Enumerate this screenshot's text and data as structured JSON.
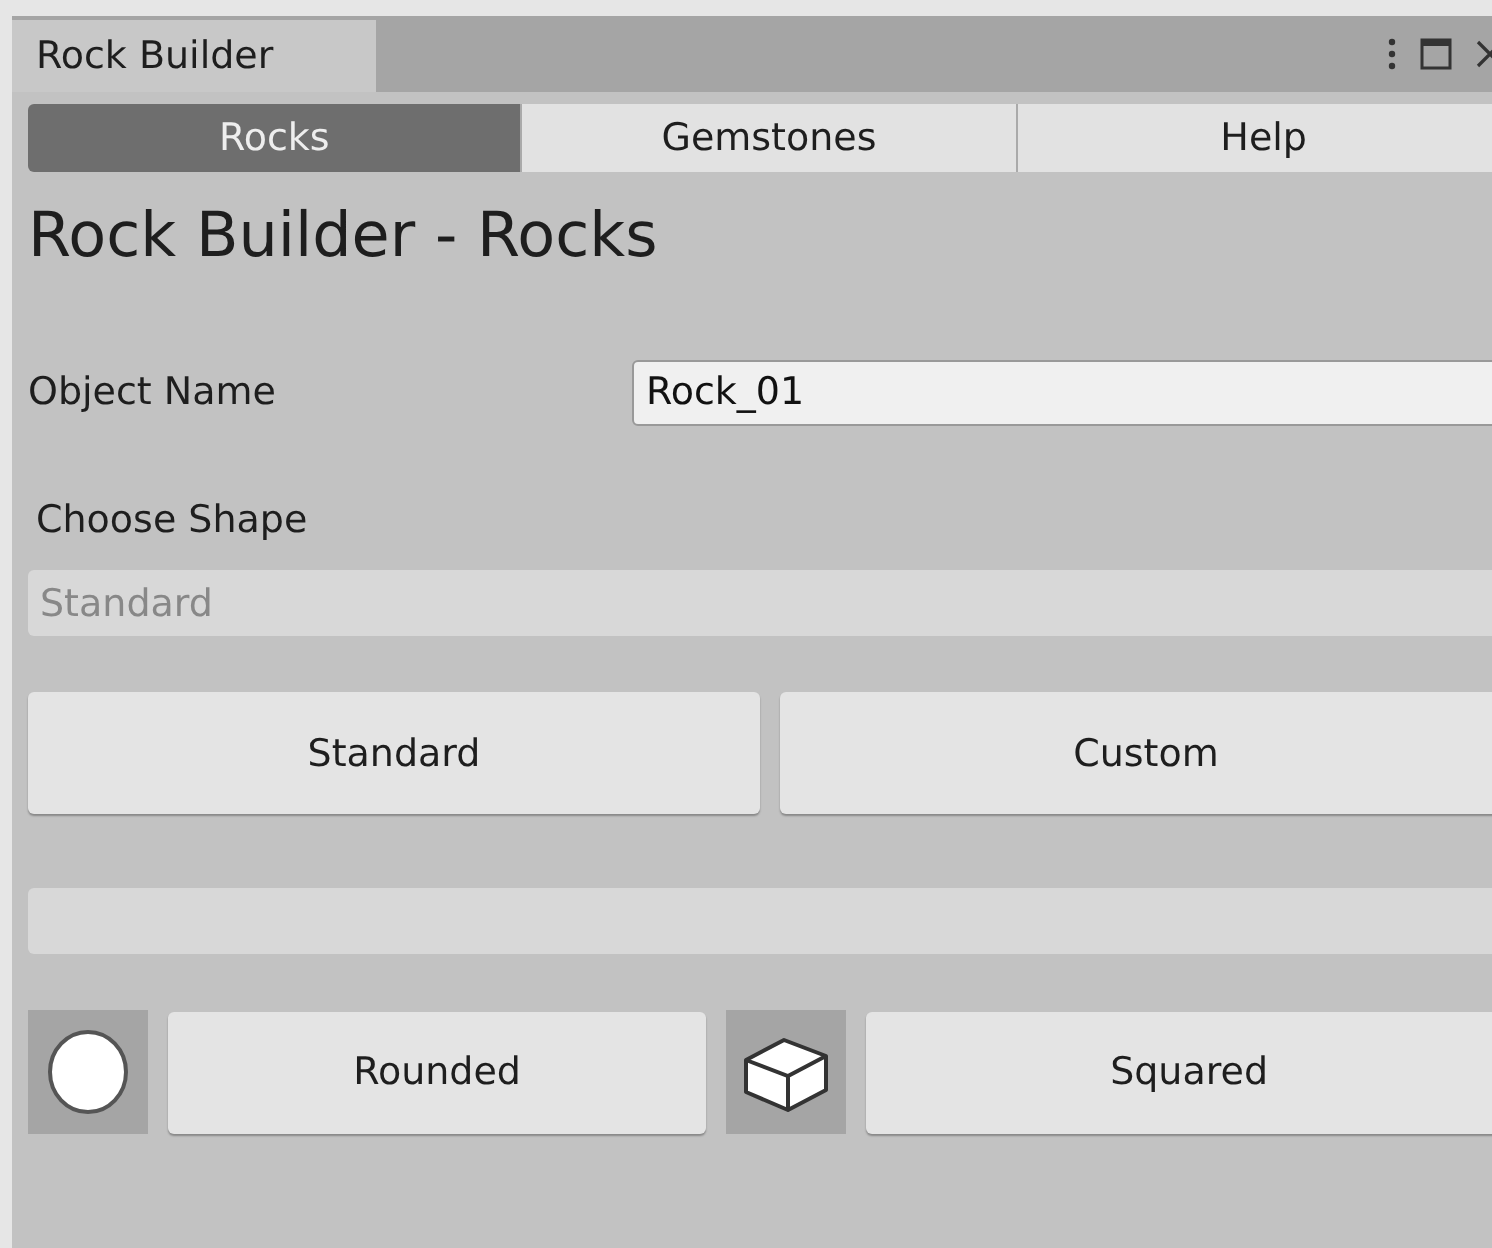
{
  "window": {
    "title": "Rock Builder"
  },
  "tabs": [
    {
      "label": "Rocks",
      "selected": true
    },
    {
      "label": "Gemstones",
      "selected": false
    },
    {
      "label": "Help",
      "selected": false
    }
  ],
  "heading": "Rock Builder - Rocks",
  "object_name": {
    "label": "Object Name",
    "value": "Rock_01"
  },
  "shape": {
    "label": "Choose Shape",
    "value": "Standard",
    "disabled": true
  },
  "shape_buttons": [
    "Standard",
    "Custom"
  ],
  "style_options": [
    {
      "kind": "sphere",
      "label": "Rounded"
    },
    {
      "kind": "box",
      "label": "Squared"
    }
  ]
}
